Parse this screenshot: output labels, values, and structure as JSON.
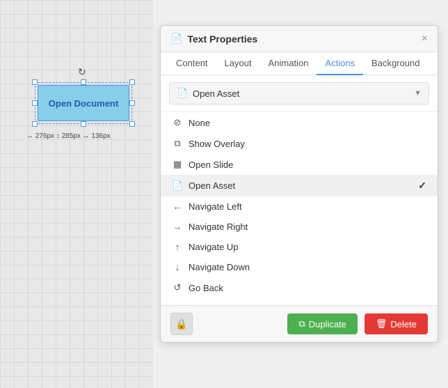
{
  "canvas": {
    "element_label": "Open Document",
    "size_label": "↔ 276px  ↕ 285px  ↔ 136px"
  },
  "panel": {
    "title": "Text Properties",
    "close_label": "×",
    "tabs": [
      {
        "id": "content",
        "label": "Content",
        "active": false
      },
      {
        "id": "layout",
        "label": "Layout",
        "active": false
      },
      {
        "id": "animation",
        "label": "Animation",
        "active": false
      },
      {
        "id": "actions",
        "label": "Actions",
        "active": true
      },
      {
        "id": "background",
        "label": "Background",
        "active": false
      }
    ],
    "dropdown": {
      "selected_label": "Open Asset",
      "icon": "📄"
    },
    "menu_items": [
      {
        "id": "none",
        "label": "None",
        "icon": "⊘",
        "selected": false
      },
      {
        "id": "show-overlay",
        "label": "Show Overlay",
        "icon": "⧉",
        "selected": false
      },
      {
        "id": "open-slide",
        "label": "Open Slide",
        "icon": "▦",
        "selected": false
      },
      {
        "id": "open-asset",
        "label": "Open Asset",
        "icon": "📄",
        "selected": true
      },
      {
        "id": "navigate-left",
        "label": "Navigate Left",
        "icon": "←",
        "selected": false
      },
      {
        "id": "navigate-right",
        "label": "Navigate Right",
        "icon": "→",
        "selected": false
      },
      {
        "id": "navigate-up",
        "label": "Navigate Up",
        "icon": "↑",
        "selected": false
      },
      {
        "id": "navigate-down",
        "label": "Navigate Down",
        "icon": "↓",
        "selected": false
      },
      {
        "id": "go-back",
        "label": "Go Back",
        "icon": "↺",
        "selected": false
      }
    ],
    "footer": {
      "lock_icon": "🔒",
      "duplicate_label": "Duplicate",
      "delete_label": "Delete",
      "duplicate_icon": "⧉",
      "delete_icon": "🗑"
    }
  }
}
